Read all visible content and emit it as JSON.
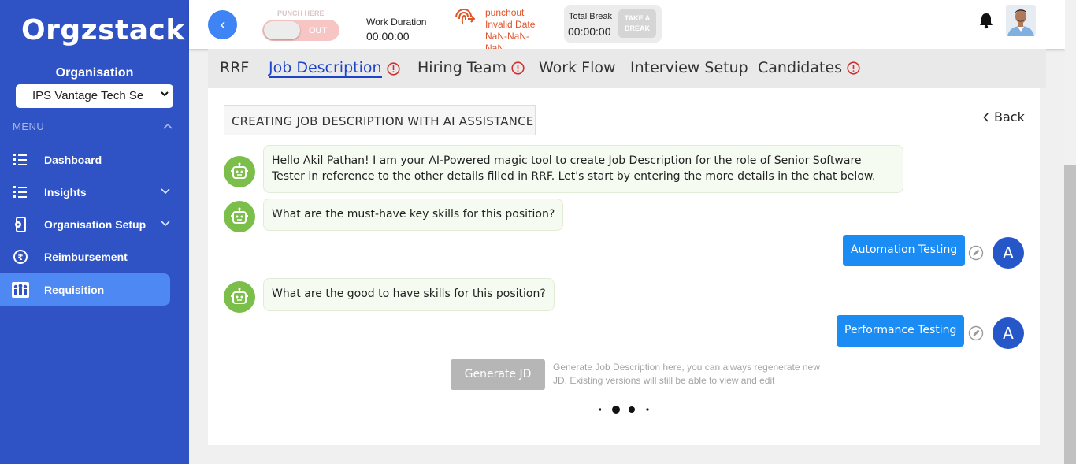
{
  "sidebar": {
    "logo": "Orgzstack",
    "org_label": "Organisation",
    "org_select_value": "IPS Vantage Tech Se",
    "menu_label": "MENU",
    "items": [
      {
        "label": "Dashboard",
        "icon": "list-icon"
      },
      {
        "label": "Insights",
        "icon": "list-icon"
      },
      {
        "label": "Organisation Setup",
        "icon": "mobile-gear-icon"
      },
      {
        "label": "Reimbursement",
        "icon": "money-cycle-icon"
      },
      {
        "label": "Requisition",
        "icon": "people-icon"
      }
    ]
  },
  "header": {
    "punch_label": "PUNCH HERE",
    "punch_state": "OUT",
    "work_duration_label": "Work Duration",
    "work_duration_value": "00:00:00",
    "punchout_text": "punchout Invalid Date NaN-NaN-NaN",
    "total_break_label": "Total Break",
    "total_break_value": "00:00:00",
    "take_break_label": "TAKE A BREAK"
  },
  "tabs": [
    {
      "label": "RRF",
      "warning": false
    },
    {
      "label": "Job Description",
      "warning": true,
      "active": true
    },
    {
      "label": "Hiring Team",
      "warning": true
    },
    {
      "label": "Work Flow",
      "warning": false
    },
    {
      "label": "Interview Setup",
      "warning": false
    },
    {
      "label": "Candidates",
      "warning": true
    }
  ],
  "main": {
    "section_title": "CREATING JOB DESCRIPTION WITH AI ASSISTANCE",
    "back_label": "Back",
    "messages": [
      {
        "from": "bot",
        "text": "Hello Akil Pathan! I am your AI-Powered magic tool to create Job Description for the role of Senior Software Tester in reference to the other details filled in RRF. Let's start by entering the more details in the chat below."
      },
      {
        "from": "bot",
        "text": "What are the must-have key skills for this position?"
      },
      {
        "from": "user",
        "text": "Automation Testing",
        "avatar": "A"
      },
      {
        "from": "bot",
        "text": "What are the good to have skills for this position?"
      },
      {
        "from": "user",
        "text": "Performance Testing",
        "avatar": "A"
      }
    ],
    "generate_button": "Generate JD",
    "generate_hint": "Generate Job Description here, you can always regenerate new JD. Existing versions will still be able to view and edit"
  },
  "colors": {
    "sidebar_bg": "#2f52c4",
    "active_nav": "#4d88f3",
    "tab_active": "#1d44c8",
    "warning": "#d32f2f",
    "bot_avatar": "#7bbf4a",
    "user_bubble": "#1a8cf3",
    "user_avatar": "#2557c9"
  }
}
